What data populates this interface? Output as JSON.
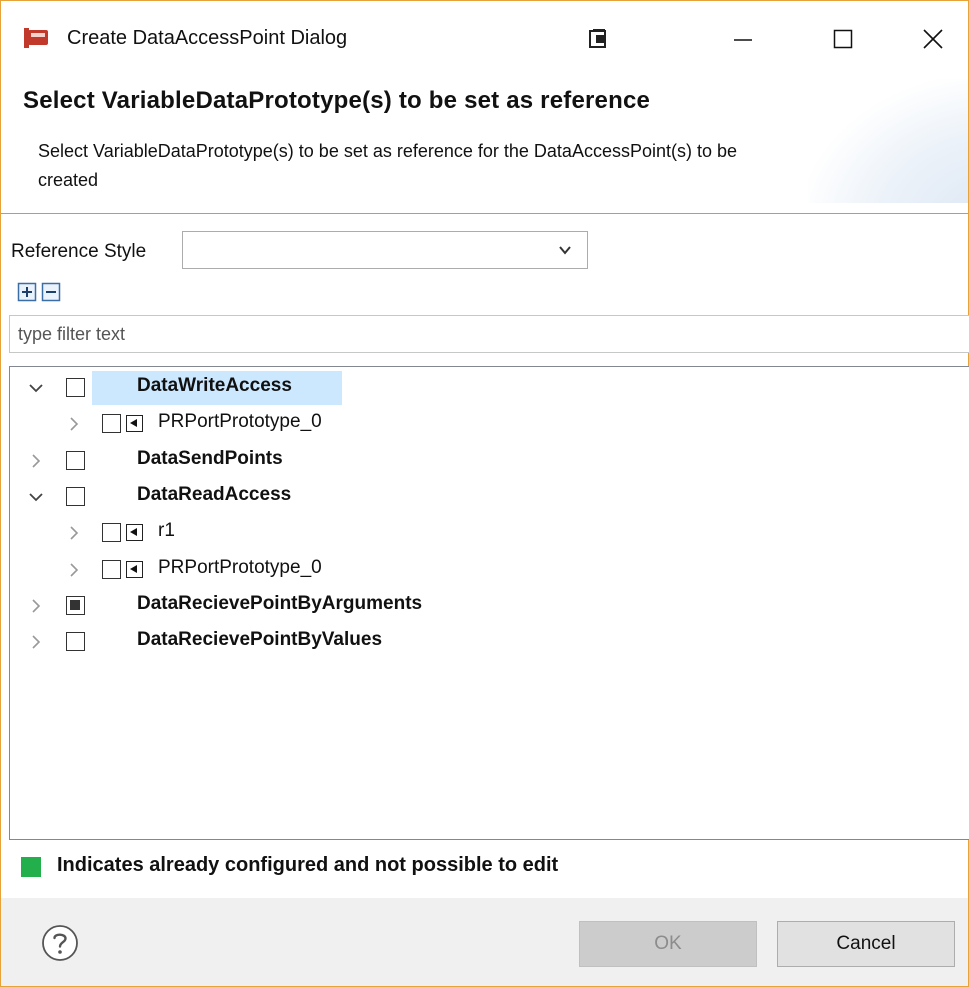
{
  "window": {
    "title": "Create DataAccessPoint Dialog",
    "app_icon": "app-logo-icon",
    "controls": [
      "minimize-icon",
      "maximize-icon",
      "close-icon"
    ]
  },
  "header": {
    "title": "Select VariableDataPrototype(s) to be set as reference",
    "description": "Select VariableDataPrototype(s) to be set as reference for the DataAccessPoint(s) to be created"
  },
  "reference_style": {
    "label": "Reference Style",
    "value": ""
  },
  "filter": {
    "placeholder": "type filter text",
    "value": ""
  },
  "tree": {
    "items": [
      {
        "label": "DataWriteAccess",
        "bold": true,
        "expanded": true,
        "checked": false,
        "selected": true
      },
      {
        "label": "PRPortPrototype_0",
        "bold": false,
        "expanded": false,
        "checked": false,
        "icon": "port-prototype-icon"
      },
      {
        "label": "DataSendPoints",
        "bold": true,
        "expanded": false,
        "checked": false
      },
      {
        "label": "DataReadAccess",
        "bold": true,
        "expanded": true,
        "checked": false
      },
      {
        "label": "r1",
        "bold": false,
        "expanded": false,
        "checked": false,
        "icon": "port-prototype-icon"
      },
      {
        "label": "PRPortPrototype_0",
        "bold": false,
        "expanded": false,
        "checked": false,
        "icon": "port-prototype-icon"
      },
      {
        "label": "DataRecievePointByArguments",
        "bold": true,
        "expanded": false,
        "checked": "partial"
      },
      {
        "label": "DataRecievePointByValues",
        "bold": true,
        "expanded": false,
        "checked": false
      }
    ]
  },
  "legend": {
    "text": "Indicates already configured and not possible to edit",
    "color": "#23b04c"
  },
  "footer": {
    "ok_label": "OK",
    "cancel_label": "Cancel",
    "ok_enabled": false
  }
}
